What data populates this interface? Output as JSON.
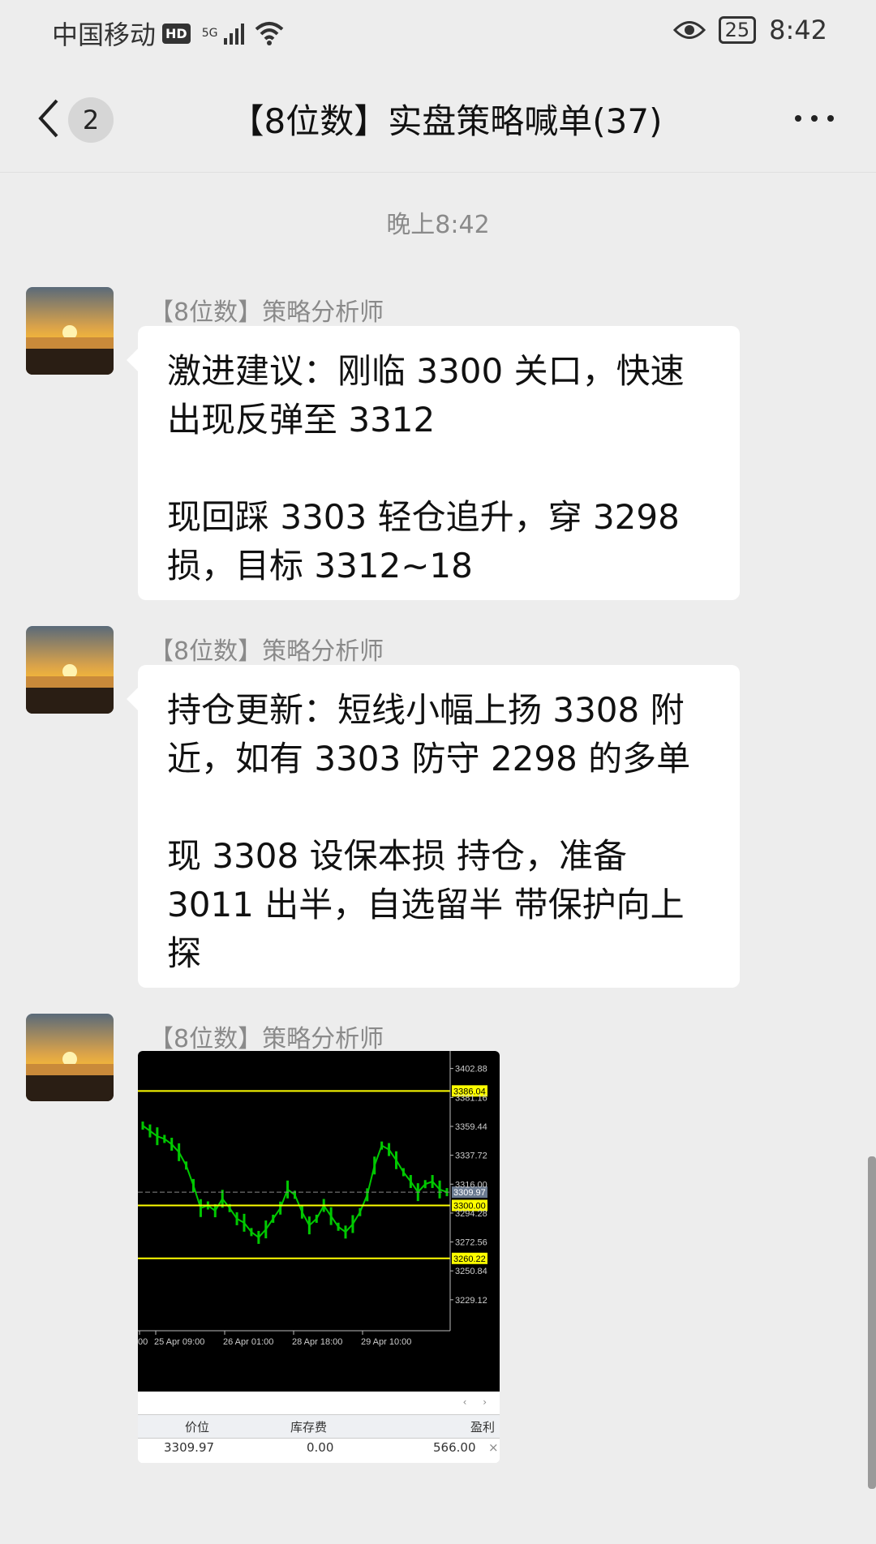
{
  "status_bar": {
    "carrier": "中国移动",
    "hd": "HD",
    "network": "5G",
    "battery": "25",
    "time": "8:42"
  },
  "nav": {
    "back_icon": "chevron-left-icon",
    "unread_count": "2",
    "title": "【8位数】实盘策略喊单(37)",
    "more_icon": "more-dots-icon"
  },
  "chat": {
    "timestamp": "晚上8:42",
    "messages": [
      {
        "sender": "【8位数】策略分析师",
        "avatar": "sunset-avatar",
        "text": "激进建议：刚临 3300 关口，快速出现反弹至 3312\n\n现回踩 3303 轻仓追升，穿 3298 损，目标 3312~18"
      },
      {
        "sender": "【8位数】策略分析师",
        "avatar": "sunset-avatar",
        "text": "持仓更新：短线小幅上扬 3308 附近，如有 3303 防守 2298 的多单\n\n现 3308 设保本损 持仓，准备 3011 出半，自选留半 带保护向上探"
      },
      {
        "sender": "【8位数】策略分析师",
        "avatar": "sunset-avatar",
        "image": {
          "chart_data": {
            "type": "line",
            "y_ticks": [
              "3402.88",
              "3381.16",
              "3359.44",
              "3337.72",
              "3316.00",
              "3294.28",
              "3272.56",
              "3250.84",
              "3229.12"
            ],
            "ylim": [
              3215,
              3410
            ],
            "levels": [
              {
                "label": "3386.04",
                "value": 3386.04
              },
              {
                "label": "3300.00",
                "value": 3300.0
              },
              {
                "label": "3260.22",
                "value": 3260.22
              }
            ],
            "current_price": {
              "label": "3309.97",
              "value": 3309.97
            },
            "x_ticks": [
              "00",
              "25 Apr 09:00",
              "26 Apr 01:00",
              "28 Apr 18:00",
              "29 Apr 10:00"
            ],
            "series": [
              {
                "values": [
                  3360,
                  3356,
                  3352,
                  3350,
                  3346,
                  3340,
                  3330,
                  3315,
                  3298,
                  3300,
                  3296,
                  3305,
                  3298,
                  3290,
                  3287,
                  3280,
                  3276,
                  3282,
                  3290,
                  3298,
                  3312,
                  3308,
                  3295,
                  3285,
                  3290,
                  3300,
                  3292,
                  3284,
                  3280,
                  3286,
                  3295,
                  3308,
                  3330,
                  3345,
                  3342,
                  3334,
                  3325,
                  3318,
                  3310,
                  3316,
                  3318,
                  3312,
                  3310
                ]
              }
            ]
          },
          "table": {
            "headers": [
              "价位",
              "库存费",
              "盈利"
            ],
            "row": [
              "3309.97",
              "0.00",
              "566.00"
            ],
            "close": "×",
            "scroll_arrows": "‹ ›"
          }
        }
      }
    ]
  },
  "colors": {
    "background": "#ededed",
    "bubble": "#ffffff",
    "chart_bg": "#000000",
    "candle": "#00c800",
    "level_line": "#ffff00"
  }
}
